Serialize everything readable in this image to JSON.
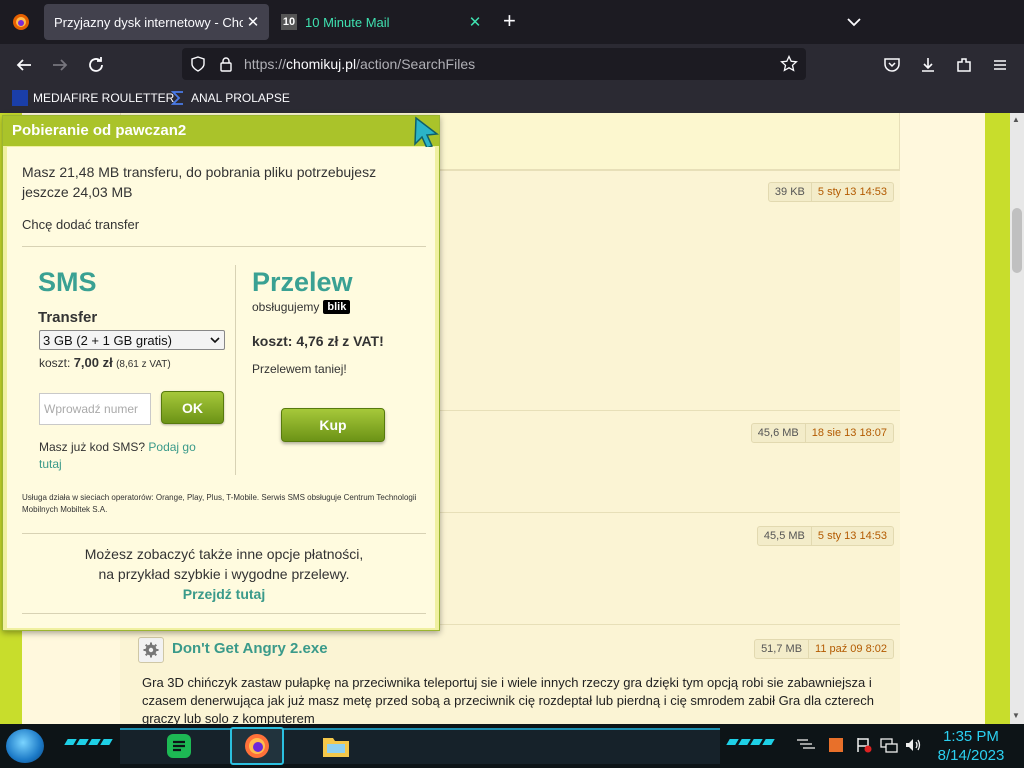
{
  "browser": {
    "tabs": [
      {
        "title": "Przyjazny dysk internetowy - Chomikuj.pl",
        "active": true
      },
      {
        "title": "10 Minute Mail",
        "active": false,
        "favicon_text": "10"
      }
    ],
    "url_prefix": "https://",
    "url_host": "chomikuj.pl",
    "url_path": "/action/SearchFiles",
    "bookmarks": [
      {
        "label": "MEDIAFIRE ROULETTER"
      },
      {
        "label": "ANAL PROLAPSE"
      }
    ]
  },
  "page": {
    "rows": [
      {
        "size": "39 KB",
        "date": "5 sty 13 14:53"
      },
      {
        "size": "45,6 MB",
        "date": "18 sie 13 18:07"
      },
      {
        "size": "45,5 MB",
        "date": "5 sty 13 14:53"
      },
      {
        "size": "51,7 MB",
        "date": "11 paź 09 8:02"
      }
    ],
    "file_name": "Don't Get Angry 2.exe",
    "file_desc": "Gra 3D chińczyk zastaw pułapkę na przeciwnika teleportuj sie i wiele innych rzeczy gra dzięki tym opcją robi sie zabawniejsza i czasem denerwująca jak już masz metę przed sobą a przeciwnik cię rozdeptał lub pierdną i cię smrodem zabił Gra dla czterech graczy lub solo z komputerem"
  },
  "modal": {
    "title": "Pobieranie od pawczan2",
    "message": "Masz 21,48 MB transferu, do pobrania pliku potrzebujesz jeszcze 24,03 MB",
    "add_transfer": "Chcę dodać transfer",
    "sms": {
      "title": "SMS",
      "transfer_label": "Transfer",
      "select_value": "3 GB (2 + 1 GB gratis)",
      "cost_label": "koszt:",
      "cost_value": "7,00 zł",
      "cost_vat": "(8,61 z VAT)",
      "input_placeholder": "Wprowadź numer",
      "ok_label": "OK",
      "have_code": "Masz już kod SMS?",
      "have_code_link": "Podaj go tutaj"
    },
    "przelew": {
      "title": "Przelew",
      "supported": "obsługujemy",
      "blik": "blik",
      "cost": "koszt: 4,76 zł z VAT!",
      "cheaper": "Przelewem taniej!",
      "buy_label": "Kup"
    },
    "operators": "Usługa działa w sieciach operatorów: Orange, Play, Plus, T-Mobile. Serwis SMS obsługuje Centrum Technologii Mobilnych Mobiltek S.A.",
    "more_line1": "Możesz zobaczyć także inne opcje płatności,",
    "more_line2": "na przykład szybkie i wygodne przelewy.",
    "more_link": "Przejdź tutaj"
  },
  "taskbar": {
    "time": "1:35 PM",
    "date": "8/14/2023"
  },
  "colors": {
    "accent_green": "#aac32a",
    "teal": "#3aa193",
    "page_bg": "#c8dd2c"
  }
}
